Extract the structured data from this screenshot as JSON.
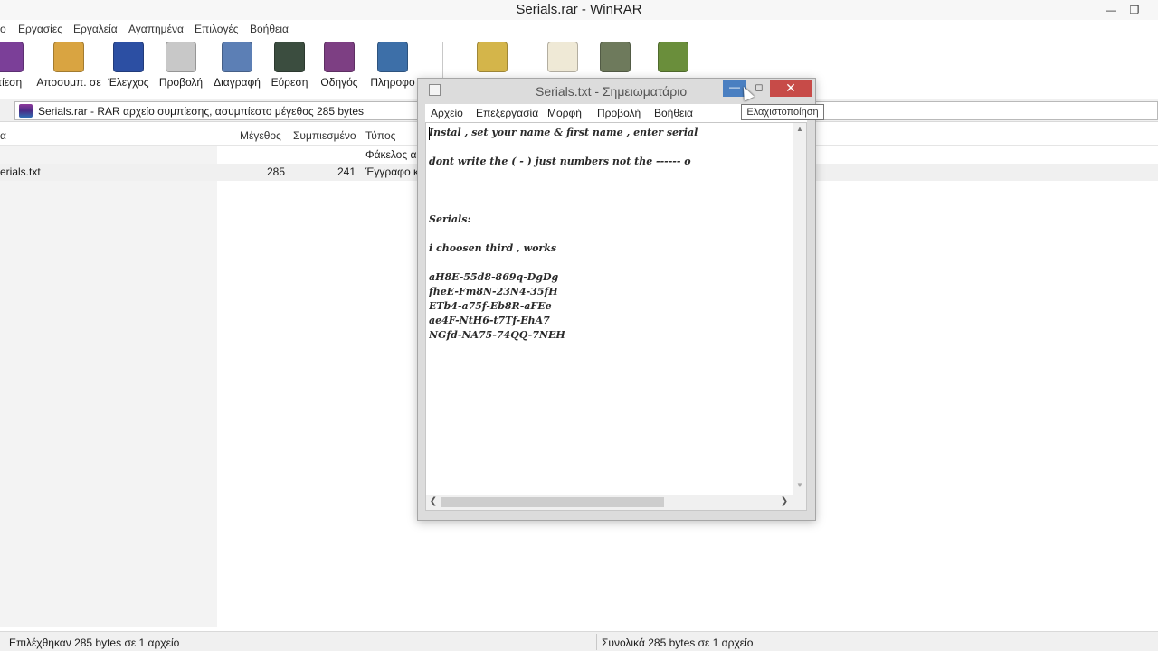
{
  "winrar": {
    "title": "Serials.rar - WinRAR",
    "menu": [
      "ο",
      "Εργασίες",
      "Εργαλεία",
      "Αγαπημένα",
      "Επιλογές",
      "Βοήθεια"
    ],
    "toolbar": [
      {
        "label": "πίεση",
        "icon": "add-archive-icon",
        "color": "#7b3f98"
      },
      {
        "label": "Αποσυμπ. σε",
        "icon": "extract-to-icon",
        "color": "#d9a441"
      },
      {
        "label": "Έλεγχος",
        "icon": "test-icon",
        "color": "#2c4fa3"
      },
      {
        "label": "Προβολή",
        "icon": "view-icon",
        "color": "#c8c8c8"
      },
      {
        "label": "Διαγραφή",
        "icon": "delete-icon",
        "color": "#5c7fb5"
      },
      {
        "label": "Εύρεση",
        "icon": "find-icon",
        "color": "#3b4d3f"
      },
      {
        "label": "Οδηγός",
        "icon": "wizard-icon",
        "color": "#7d3f83"
      },
      {
        "label": "Πληροφο",
        "icon": "info-icon",
        "color": "#3d6fa8"
      },
      {
        "label": "",
        "icon": "virus-scan-icon",
        "color": "#d4b54a"
      },
      {
        "label": "",
        "icon": "comment-icon",
        "color": "#efe9d6"
      },
      {
        "label": "",
        "icon": "protect-icon",
        "color": "#6e7a5c"
      },
      {
        "label": "",
        "icon": "sfx-icon",
        "color": "#6a8e3b"
      }
    ],
    "path_text": "Serials.rar - RAR αρχείο συμπίεσης, ασυμπίεστο μέγεθος 285 bytes",
    "columns": {
      "name": "α",
      "size": "Μέγεθος",
      "packed": "Συμπιεσμένο",
      "type": "Τύπος"
    },
    "rows": [
      {
        "name": "",
        "size": "",
        "packed": "",
        "type": "Φάκελος α"
      },
      {
        "name": "erials.txt",
        "size": "285",
        "packed": "241",
        "type": "Έγγραφο κ"
      }
    ],
    "status_left": "Επιλέχθηκαν 285 bytes σε 1 αρχείο",
    "status_right": "Συνολικά 285 bytes σε 1 αρχείο"
  },
  "notepad": {
    "title": "Serials.txt - Σημειωματάριο",
    "menu": [
      "Αρχείο",
      "Επεξεργασία",
      "Μορφή",
      "Προβολή",
      "Βοήθεια"
    ],
    "content": "Instal , set your name & first name , enter serial\n\ndont write the ( - ) just numbers not the ------ o\n\n\n\nSerials:\n\ni choosen third , works\n\naH8E-55d8-869q-DgDg\nfheE-Fm8N-23N4-35fH\nETb4-a75f-Eb8R-aFEe\nae4F-NtH6-t7Tf-EhA7\nNGfd-NA75-74QQ-7NEH"
  },
  "tooltip": "Ελαχιστοποίηση"
}
